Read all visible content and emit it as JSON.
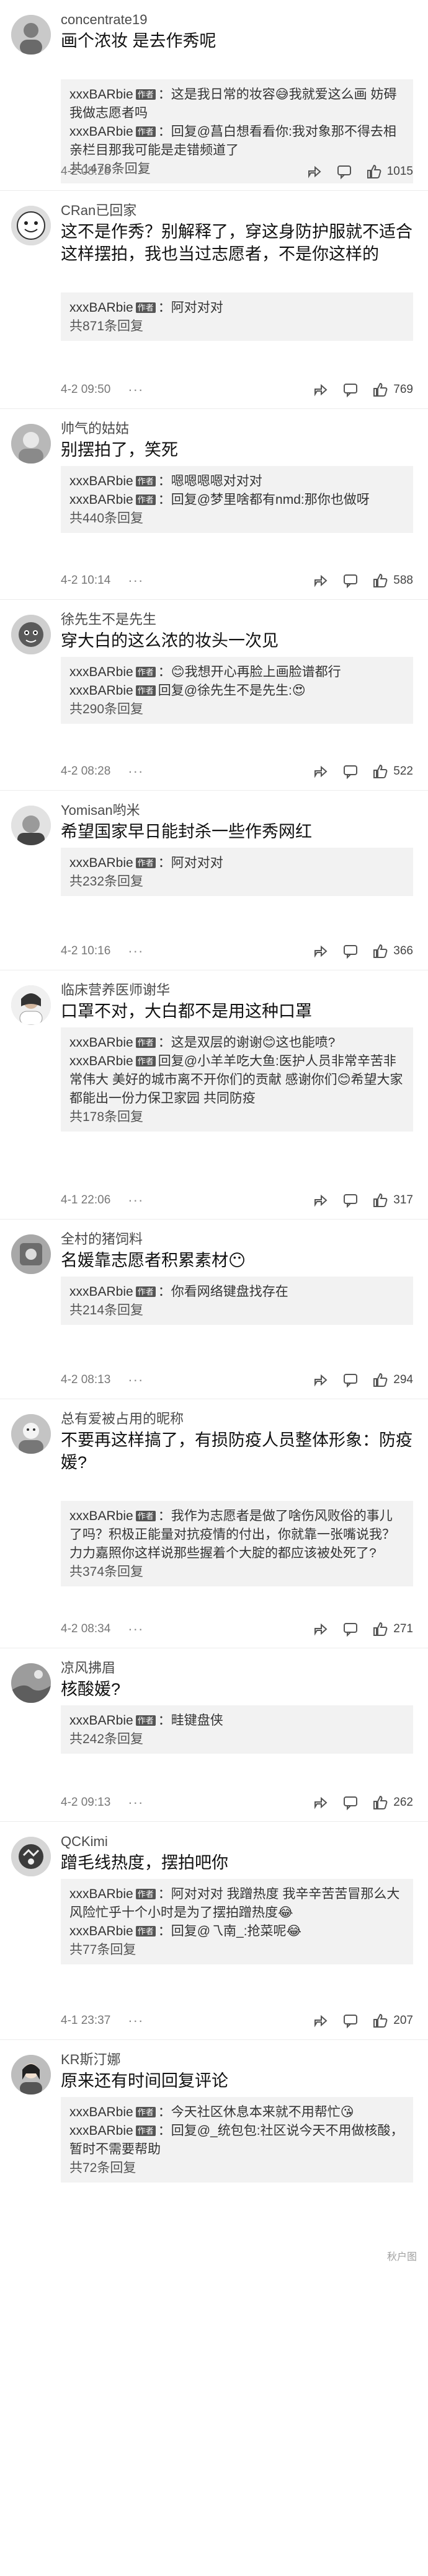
{
  "comments": [
    {
      "user": "concentrate19",
      "content": "画个浓妆 是去作秀呢",
      "replies": [
        {
          "user": "xxxBARbie",
          "text": "：这是我日常的妆容😅我就爱这么画 妨碍我做志愿者吗"
        },
        {
          "user": "xxxBARbie",
          "text": "：回复@菖白想看看你:我对象那不得去相亲栏目那我可能是走错频道了"
        }
      ],
      "more": "共1478条回复",
      "time": "4-2 08:28",
      "likes": "1015"
    },
    {
      "user": "CRan已回家",
      "content": "这不是作秀？别解释了，穿这身防护服就不适合这样摆拍，我也当过志愿者，不是你这样的",
      "replies": [
        {
          "user": "xxxBARbie",
          "text": "：阿对对对"
        }
      ],
      "more": "共871条回复",
      "time": "4-2 09:50",
      "likes": "769"
    },
    {
      "user": "帅气的姑姑",
      "content": "别摆拍了，笑死",
      "replies": [
        {
          "user": "xxxBARbie",
          "text": "：嗯嗯嗯嗯对对对"
        },
        {
          "user": "xxxBARbie",
          "text": "：回复@梦里啥都有nmd:那你也做呀"
        }
      ],
      "more": "共440条回复",
      "time": "4-2 10:14",
      "likes": "588"
    },
    {
      "user": "徐先生不是先生",
      "content": "穿大白的这么浓的妆头一次见",
      "replies": [
        {
          "user": "xxxBARbie",
          "text": "：😊我想开心再脸上画脸谱都行"
        },
        {
          "user": "xxxBARbie",
          "text": "回复@徐先生不是先生:😍"
        }
      ],
      "more": "共290条回复",
      "time": "4-2 08:28",
      "likes": "522"
    },
    {
      "user": "Yomisan哟米",
      "content": "希望国家早日能封杀一些作秀网红",
      "replies": [
        {
          "user": "xxxBARbie",
          "text": "：阿对对对"
        }
      ],
      "more": "共232条回复",
      "time": "4-2 10:16",
      "likes": "366"
    },
    {
      "user": "临床营养医师谢华",
      "content": "口罩不对，大白都不是用这种口罩",
      "replies": [
        {
          "user": "xxxBARbie",
          "text": "：这是双层的谢谢😊这也能喷?"
        },
        {
          "user": "xxxBARbie",
          "text": "回复@小羊羊吃大鱼:医护人员非常辛苦非常伟大 美好的城市离不开你们的贡献 感谢你们😊希望大家都能出一份力保卫家园 共同防疫"
        }
      ],
      "more": "共178条回复",
      "time": "4-1 22:06",
      "likes": "317"
    },
    {
      "user": "全村的猪饲料",
      "content": "名媛靠志愿者积累素材😶",
      "replies": [
        {
          "user": "xxxBARbie",
          "text": "：你看网络键盘找存在"
        }
      ],
      "more": "共214条回复",
      "time": "4-2 08:13",
      "likes": "294"
    },
    {
      "user": "总有爱被占用的昵称",
      "content": "不要再这样搞了，有损防疫人员整体形象：防疫媛?",
      "replies": [
        {
          "user": "xxxBARbie",
          "text": "：我作为志愿者是做了啥伤风败俗的事儿了吗？积极正能量对抗疫情的付出，你就靠一张嘴说我？"
        },
        {
          "user": "力力嘉",
          "text": "照你这样说那些握着个大腚的都应该被处死了?"
        }
      ],
      "more": "共374条回复",
      "time": "4-2 08:34",
      "likes": "271"
    },
    {
      "user": "凉风拂眉",
      "content": "核酸媛?",
      "replies": [
        {
          "user": "xxxBARbie",
          "text": "：畦键盘侠"
        }
      ],
      "more": "共242条回复",
      "time": "4-2 09:13",
      "likes": "262"
    },
    {
      "user": "QCKimi",
      "content": "蹭毛线热度，摆拍吧你",
      "replies": [
        {
          "user": "xxxBARbie",
          "text": "：阿对对对 我蹭热度 我辛辛苦苦冒那么大风险忙乎十个小时是为了摆拍蹭热度😂"
        },
        {
          "user": "xxxBARbie",
          "text": "：回复@乁南_:抢菜呢😂"
        }
      ],
      "more": "共77条回复",
      "time": "4-1 23:37",
      "likes": "207"
    },
    {
      "user": "KR斯汀娜",
      "content": "原来还有时间回复评论",
      "replies": [
        {
          "user": "xxxBARbie",
          "text": "：今天社区休息本来就不用帮忙😘"
        },
        {
          "user": "xxxBARbie",
          "text": "：回复@_统包包:社区说今天不用做核酸，暂时不需要帮助"
        }
      ],
      "more": "共72条回复",
      "time": "",
      "likes": ""
    }
  ],
  "labels": {
    "author_tag": "作者",
    "dots": "···",
    "watermark": "秋户图"
  },
  "icons": {
    "share": "share-icon",
    "comment": "comment-icon",
    "like": "thumbs-up-icon"
  }
}
